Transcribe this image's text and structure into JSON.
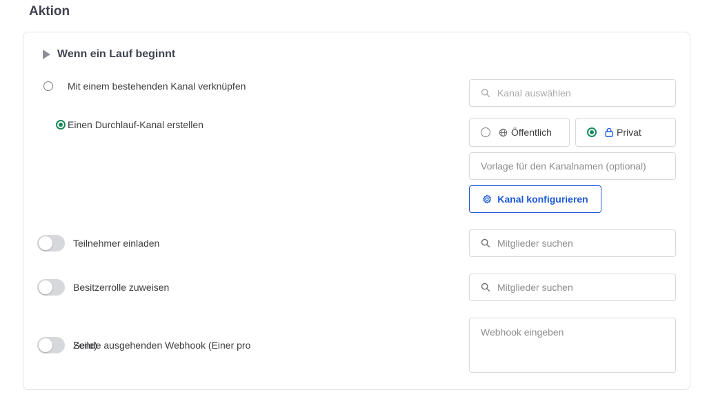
{
  "section": {
    "title": "Aktion"
  },
  "trigger": {
    "label": "Wenn ein Lauf beginnt"
  },
  "channel_options": {
    "link_existing": {
      "label": "Mit einem bestehenden Kanal verknüpfen",
      "selected": false
    },
    "create_new": {
      "label": "Einen Durchlauf-Kanal erstellen",
      "selected": true
    }
  },
  "channel_select": {
    "placeholder": "Kanal auswählen"
  },
  "visibility": {
    "public": {
      "label": "Öffentlich",
      "selected": false
    },
    "private": {
      "label": "Privat",
      "selected": true
    }
  },
  "channel_name_template": {
    "placeholder": "Vorlage für den Kanalnamen (optional)"
  },
  "configure_button": {
    "label": "Kanal konfigurieren"
  },
  "invite": {
    "label": "Teilnehmer einladen",
    "enabled": false,
    "search_placeholder": "Mitglieder suchen"
  },
  "owner": {
    "label": "Besitzerrolle zuweisen",
    "enabled": false,
    "search_placeholder": "Mitglieder suchen"
  },
  "webhook": {
    "label_line1": "Sende ausgehenden Webhook (Einer pro",
    "label_line2": "Zeile)",
    "enabled": false,
    "placeholder": "Webhook eingeben"
  },
  "colors": {
    "accent_green": "#1a8a5b",
    "accent_blue": "#1c58d9",
    "border": "#d7d8db"
  }
}
